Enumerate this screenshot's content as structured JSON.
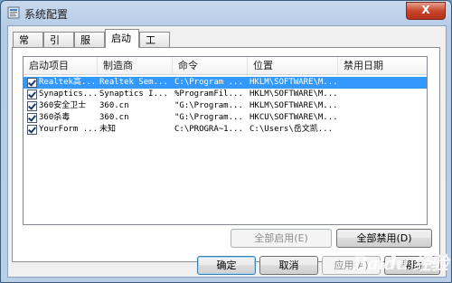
{
  "window": {
    "title": "系统配置",
    "close_label": "X"
  },
  "tabs": [
    {
      "label": "常规"
    },
    {
      "label": "引导"
    },
    {
      "label": "服务"
    },
    {
      "label": "启动"
    },
    {
      "label": "工具"
    }
  ],
  "active_tab": "启动",
  "list": {
    "columns": [
      "启动项目",
      "制造商",
      "命令",
      "位置",
      "禁用日期"
    ],
    "rows": [
      {
        "checked": true,
        "selected": true,
        "item": "Realtek高...",
        "maker": "Realtek Sem...",
        "command": "C:\\Program ...",
        "location": "HKLM\\SOFTWARE\\M...",
        "date": ""
      },
      {
        "checked": true,
        "selected": false,
        "item": "Synaptics...",
        "maker": "Synaptics I...",
        "command": "%ProgramFil...",
        "location": "HKLM\\SOFTWARE\\M...",
        "date": ""
      },
      {
        "checked": true,
        "selected": false,
        "item": "360安全卫士",
        "maker": "360.cn",
        "command": "\"G:\\Program...",
        "location": "HKLM\\SOFTWARE\\M...",
        "date": ""
      },
      {
        "checked": true,
        "selected": false,
        "item": "360杀毒",
        "maker": "360.cn",
        "command": "\"G:\\Program...",
        "location": "HKCU\\SOFTWARE\\M...",
        "date": ""
      },
      {
        "checked": true,
        "selected": false,
        "item": "YourForm ...",
        "maker": "未知",
        "command": "C:\\PROGRA~1...",
        "location": "C:\\Users\\岳文凯...",
        "date": ""
      }
    ]
  },
  "buttons": {
    "enable_all": "全部启用(E)",
    "disable_all": "全部禁用(D)",
    "ok": "确定",
    "cancel": "取消",
    "apply": "应用(A)",
    "help": "帮助"
  },
  "watermark": "Baidu 经验"
}
